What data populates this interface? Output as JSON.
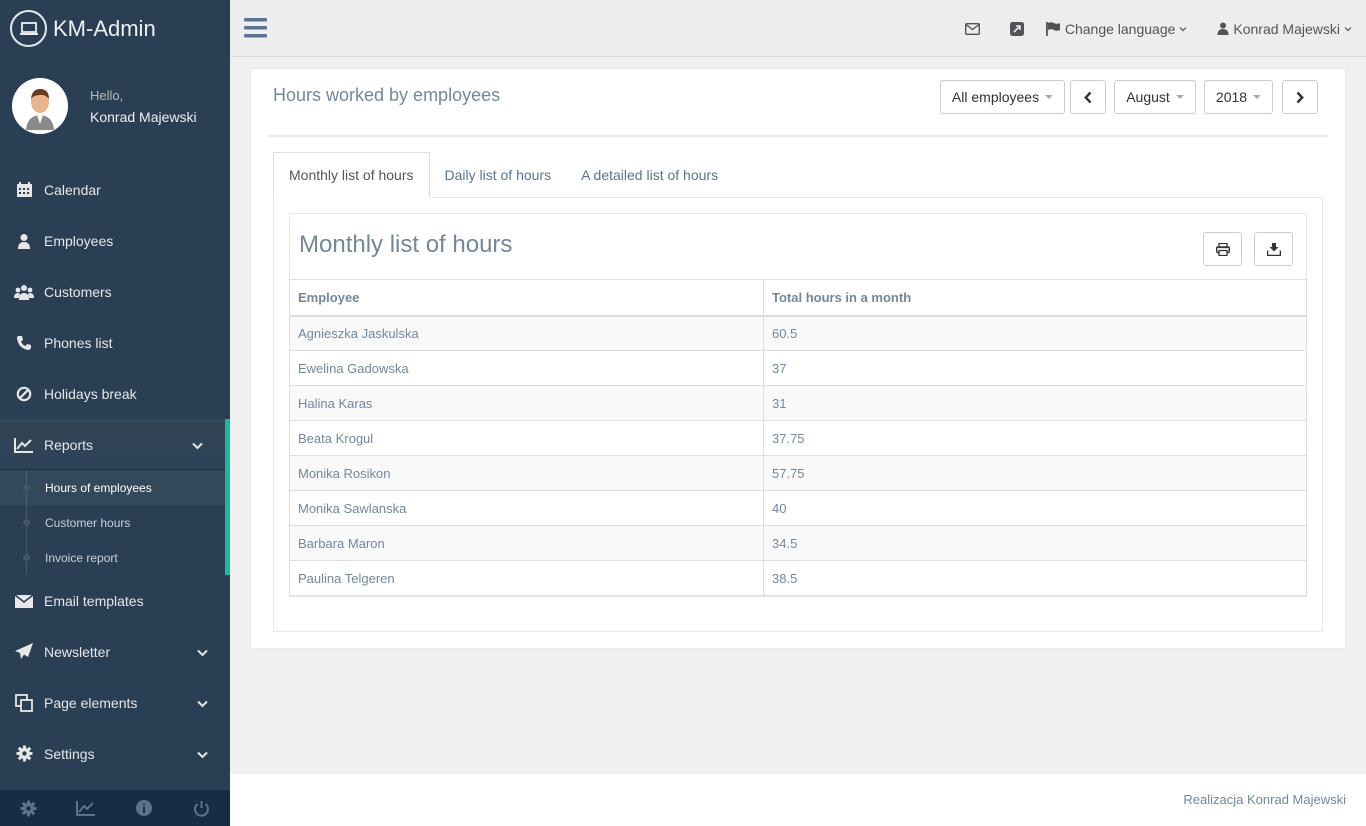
{
  "brand": {
    "title": "KM-Admin"
  },
  "profile": {
    "greeting": "Hello,",
    "name": "Konrad Majewski"
  },
  "sidebar": {
    "items": [
      {
        "label": "Calendar",
        "icon": "calendar-icon"
      },
      {
        "label": "Employees",
        "icon": "user-icon"
      },
      {
        "label": "Customers",
        "icon": "users-icon"
      },
      {
        "label": "Phones list",
        "icon": "phone-icon"
      },
      {
        "label": "Holidays break",
        "icon": "ban-icon"
      },
      {
        "label": "Reports",
        "icon": "line-chart-icon"
      },
      {
        "label": "Email templates",
        "icon": "envelope-icon"
      },
      {
        "label": "Newsletter",
        "icon": "paper-plane-icon"
      },
      {
        "label": "Page elements",
        "icon": "clone-icon"
      },
      {
        "label": "Settings",
        "icon": "gear-icon"
      }
    ],
    "reports_sub": [
      "Hours of employees",
      "Customer hours",
      "Invoice report"
    ]
  },
  "topnav": {
    "change_language": "Change language",
    "user": "Konrad Majewski"
  },
  "panel": {
    "title": "Hours worked by employees",
    "employee_filter": "All employees",
    "month": "August",
    "year": "2018"
  },
  "tabs": [
    "Monthly list of hours",
    "Daily list of hours",
    "A detailed list of hours"
  ],
  "report": {
    "title": "Monthly list of hours",
    "headers": [
      "Employee",
      "Total hours in a month"
    ],
    "rows": [
      [
        "Agnieszka Jaskulska",
        "60.5"
      ],
      [
        "Ewelina Gadowska",
        "37"
      ],
      [
        "Halina Karas",
        "31"
      ],
      [
        "Beata Krogul",
        "37.75"
      ],
      [
        "Monika Rosikon",
        "57.75"
      ],
      [
        "Monika Sawlanska",
        "40"
      ],
      [
        "Barbara Maron",
        "34.5"
      ],
      [
        "Paulina Telgeren",
        "38.5"
      ]
    ]
  },
  "footer": {
    "text": "Realizacja Konrad Majewski"
  },
  "colors": {
    "sidebar": "#2a3f54",
    "accent": "#1abb9c"
  }
}
